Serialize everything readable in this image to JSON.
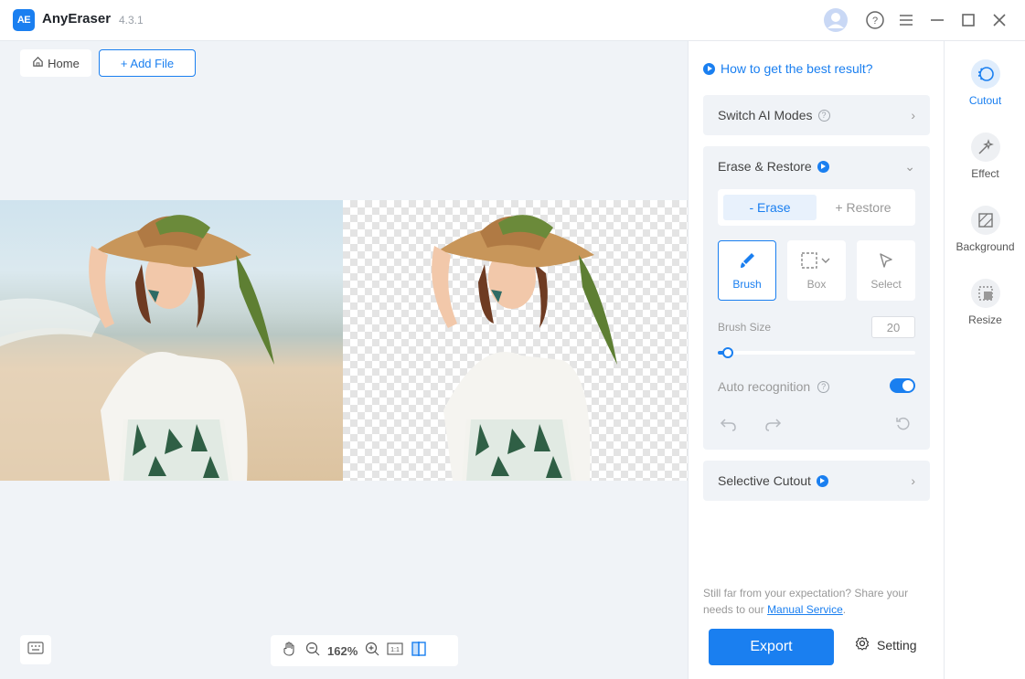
{
  "app": {
    "name": "AnyEraser",
    "version": "4.3.1",
    "logo_text": "AE"
  },
  "toolbar": {
    "home_label": "Home",
    "add_file_label": "+ Add File"
  },
  "zoom": {
    "value": "162%"
  },
  "panel": {
    "help_link": "How to get the best result?",
    "switch_ai_modes": "Switch AI Modes",
    "erase_restore": {
      "title": "Erase & Restore",
      "erase_label": "- Erase",
      "restore_label": "+ Restore",
      "tools": [
        {
          "label": "Brush",
          "icon": "brush-icon"
        },
        {
          "label": "Box",
          "icon": "box-select-icon"
        },
        {
          "label": "Select",
          "icon": "cursor-icon"
        }
      ],
      "brush_size_label": "Brush Size",
      "brush_size_value": "20",
      "brush_size_level": 0.05,
      "auto_recognition_label": "Auto recognition",
      "auto_recognition_on": true
    },
    "selective_cutout": "Selective Cutout",
    "note_text": "Still far from your expectation? Share your needs to our ",
    "note_link": "Manual Service",
    "note_end": ".",
    "export_label": "Export",
    "setting_label": "Setting"
  },
  "rail": [
    {
      "label": "Cutout",
      "icon": "cutout-icon",
      "active": true
    },
    {
      "label": "Effect",
      "icon": "effect-icon",
      "active": false
    },
    {
      "label": "Background",
      "icon": "background-icon",
      "active": false
    },
    {
      "label": "Resize",
      "icon": "resize-icon",
      "active": false
    }
  ],
  "colors": {
    "accent": "#1a7ff0",
    "workspace": "#f0f3f7",
    "panel_card": "#f0f3f7"
  }
}
